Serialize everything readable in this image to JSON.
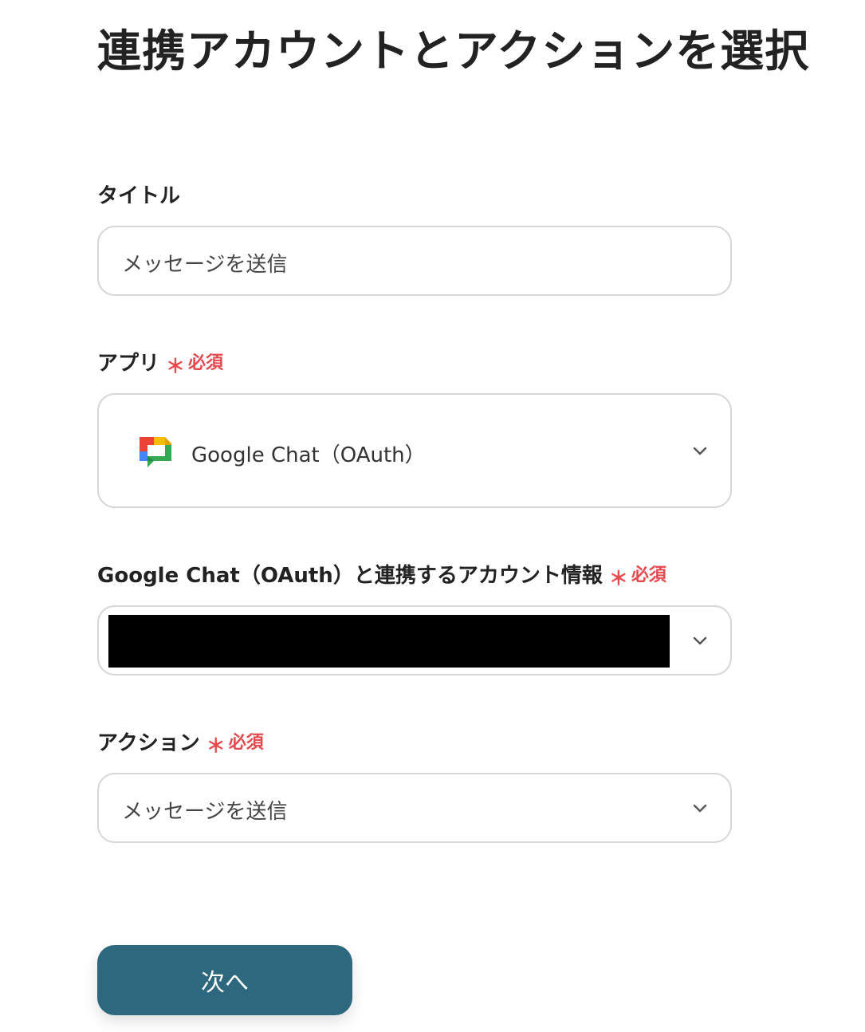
{
  "page": {
    "title": "連携アカウントとアクションを選択"
  },
  "required_mark": {
    "star": "＊",
    "text": "必須"
  },
  "fields": {
    "title": {
      "label": "タイトル",
      "value": "メッセージを送信"
    },
    "app": {
      "label": "アプリ",
      "value": "Google Chat（OAuth）",
      "icon": "google-chat-icon"
    },
    "account": {
      "label": "Google Chat（OAuth）と連携するアカウント情報",
      "value": ""
    },
    "action": {
      "label": "アクション",
      "value": "メッセージを送信"
    }
  },
  "buttons": {
    "next_label": "次へ"
  },
  "colors": {
    "required": "#e5484d",
    "primary_button": "#2e687f",
    "border": "#d6d6d6"
  }
}
